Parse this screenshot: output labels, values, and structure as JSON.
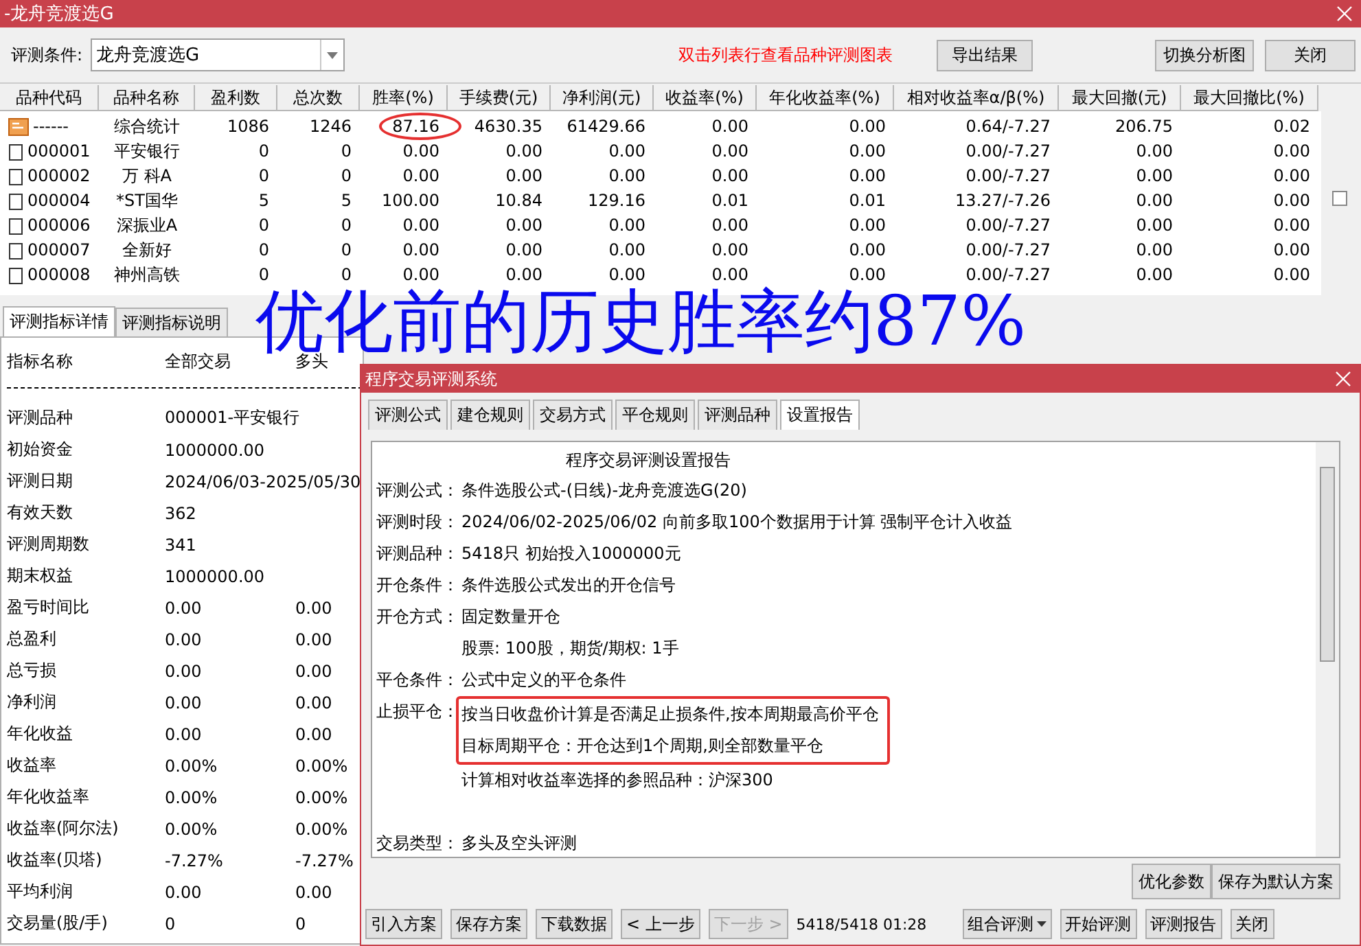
{
  "window": {
    "title": "-龙舟竞渡选G"
  },
  "toolbar": {
    "condition_label": "评测条件:",
    "condition_value": "龙舟竞渡选G",
    "hint": "双击列表行查看品种评测图表",
    "buttons": [
      "导出结果",
      "切换分析图",
      "关闭"
    ]
  },
  "table": {
    "columns": [
      "品种代码",
      "品种名称",
      "盈利数",
      "总次数",
      "胜率(%)",
      "手续费(元)",
      "净利润(元)",
      "收益率(%)",
      "年化收益率(%)",
      "相对收益率α/β(%)",
      "最大回撤(元)",
      "最大回撤比(%)"
    ],
    "rows": [
      {
        "kind": "summary",
        "cells": [
          "------",
          "综合统计",
          "1086",
          "1246",
          {
            "text": "87.16",
            "circled": true
          },
          "4630.35",
          "61429.66",
          "0.00",
          "0.00",
          "0.64/-7.27",
          "206.75",
          "0.02"
        ]
      },
      {
        "kind": "stock",
        "cells": [
          "000001",
          "平安银行",
          "0",
          "0",
          "0.00",
          "0.00",
          "0.00",
          "0.00",
          "0.00",
          "0.00/-7.27",
          "0.00",
          "0.00"
        ]
      },
      {
        "kind": "stock",
        "cells": [
          "000002",
          "万 科A",
          "0",
          "0",
          "0.00",
          "0.00",
          "0.00",
          "0.00",
          "0.00",
          "0.00/-7.27",
          "0.00",
          "0.00"
        ]
      },
      {
        "kind": "stock",
        "cells": [
          "000004",
          "*ST国华",
          "5",
          "5",
          "100.00",
          "10.84",
          "129.16",
          "0.01",
          "0.01",
          "13.27/-7.26",
          "0.00",
          "0.00"
        ]
      },
      {
        "kind": "stock",
        "cells": [
          "000006",
          "深振业A",
          "0",
          "0",
          "0.00",
          "0.00",
          "0.00",
          "0.00",
          "0.00",
          "0.00/-7.27",
          "0.00",
          "0.00"
        ]
      },
      {
        "kind": "stock",
        "cells": [
          "000007",
          "全新好",
          "0",
          "0",
          "0.00",
          "0.00",
          "0.00",
          "0.00",
          "0.00",
          "0.00/-7.27",
          "0.00",
          "0.00"
        ]
      },
      {
        "kind": "stock",
        "cells": [
          "000008",
          "神州高铁",
          "0",
          "0",
          "0.00",
          "0.00",
          "0.00",
          "0.00",
          "0.00",
          "0.00/-7.27",
          "0.00",
          "0.00"
        ]
      }
    ]
  },
  "detail_tabs": [
    {
      "label": "评测指标详情",
      "selected": true
    },
    {
      "label": "评测指标说明",
      "selected": false
    }
  ],
  "detail": {
    "columns": [
      "指标名称",
      "全部交易",
      "多头"
    ],
    "rows": [
      {
        "name": "评测品种",
        "values": [
          "000001-平安银行"
        ]
      },
      {
        "name": "初始资金",
        "values": [
          "1000000.00"
        ]
      },
      {
        "name": "评测日期",
        "values": [
          "2024/06/03-2025/05/30"
        ]
      },
      {
        "name": "有效天数",
        "values": [
          "362"
        ]
      },
      {
        "name": "评测周期数",
        "values": [
          "341"
        ]
      },
      {
        "name": "期末权益",
        "values": [
          "1000000.00"
        ]
      },
      {
        "name": "盈亏时间比",
        "values": [
          "0.00",
          "0.00"
        ]
      },
      {
        "name": "总盈利",
        "values": [
          "0.00",
          "0.00"
        ]
      },
      {
        "name": "总亏损",
        "values": [
          "0.00",
          "0.00"
        ]
      },
      {
        "name": "净利润",
        "values": [
          "0.00",
          "0.00"
        ]
      },
      {
        "name": "年化收益",
        "values": [
          "0.00",
          "0.00"
        ]
      },
      {
        "name": "收益率",
        "values": [
          "0.00%",
          "0.00%"
        ]
      },
      {
        "name": "年化收益率",
        "values": [
          "0.00%",
          "0.00%"
        ]
      },
      {
        "name": "收益率(阿尔法)",
        "values": [
          "0.00%",
          "0.00%"
        ]
      },
      {
        "name": "收益率(贝塔)",
        "values": [
          "-7.27%",
          "-7.27%"
        ]
      },
      {
        "name": "平均利润",
        "values": [
          "0.00",
          "0.00"
        ]
      },
      {
        "name": "交易量(股/手)",
        "values": [
          "0",
          "0"
        ]
      }
    ]
  },
  "annotation": {
    "text": "优化前的历史胜率约87%"
  },
  "dialog": {
    "title": "程序交易评测系统",
    "tabs": [
      {
        "label": "评测公式",
        "selected": false
      },
      {
        "label": "建仓规则",
        "selected": false
      },
      {
        "label": "交易方式",
        "selected": false
      },
      {
        "label": "平仓规则",
        "selected": false
      },
      {
        "label": "评测品种",
        "selected": false
      },
      {
        "label": "设置报告",
        "selected": true
      }
    ],
    "report": {
      "title": "程序交易评测设置报告",
      "lines": [
        {
          "label": "评测公式：",
          "text": "条件选股公式-(日线)-龙舟竞渡选G(20)",
          "highlighted": false
        },
        {
          "label": "评测时段：",
          "text": "2024/06/02-2025/06/02 向前多取100个数据用于计算 强制平仓计入收益",
          "highlighted": false
        },
        {
          "label": "评测品种：",
          "text": "5418只 初始投入1000000元",
          "highlighted": false
        },
        {
          "label": "开仓条件：",
          "text": "条件选股公式发出的开仓信号",
          "highlighted": false
        },
        {
          "label": "开仓方式：",
          "text": "固定数量开仓",
          "highlighted": false
        },
        {
          "text": "股票: 100股，期货/期权: 1手",
          "highlighted": false
        },
        {
          "label": "平仓条件：",
          "text": "公式中定义的平仓条件",
          "highlighted": false
        },
        {
          "label": "止损平仓：",
          "text": "按当日收盘价计算是否满足止损条件,按本周期最高价平仓",
          "highlighted": true
        },
        {
          "text": "目标周期平仓：开仓达到1个周期,则全部数量平仓",
          "highlighted": true
        },
        {
          "text": "计算相对收益率选择的参照品种：沪深300",
          "highlighted": false
        },
        {
          "label": "交易类型：",
          "text": "多头及空头评测",
          "highlighted": false,
          "gap_before": true
        }
      ]
    },
    "option_buttons": [
      "优化参数",
      "保存为默认方案"
    ],
    "footer": [
      {
        "kind": "button",
        "label": "引入方案",
        "disabled": false
      },
      {
        "kind": "button",
        "label": "保存方案",
        "disabled": false
      },
      {
        "kind": "button",
        "label": "下载数据",
        "disabled": false
      },
      {
        "kind": "button",
        "label": "< 上一步",
        "disabled": false
      },
      {
        "kind": "button",
        "label": "下一步 >",
        "disabled": true
      },
      {
        "kind": "status",
        "label": "5418/5418 01:28"
      },
      {
        "kind": "dropdown",
        "label": "组合评测",
        "disabled": false
      },
      {
        "kind": "button",
        "label": "开始评测",
        "disabled": false
      },
      {
        "kind": "button",
        "label": "评测报告",
        "disabled": false
      },
      {
        "kind": "button",
        "label": "关闭",
        "disabled": false
      }
    ]
  }
}
